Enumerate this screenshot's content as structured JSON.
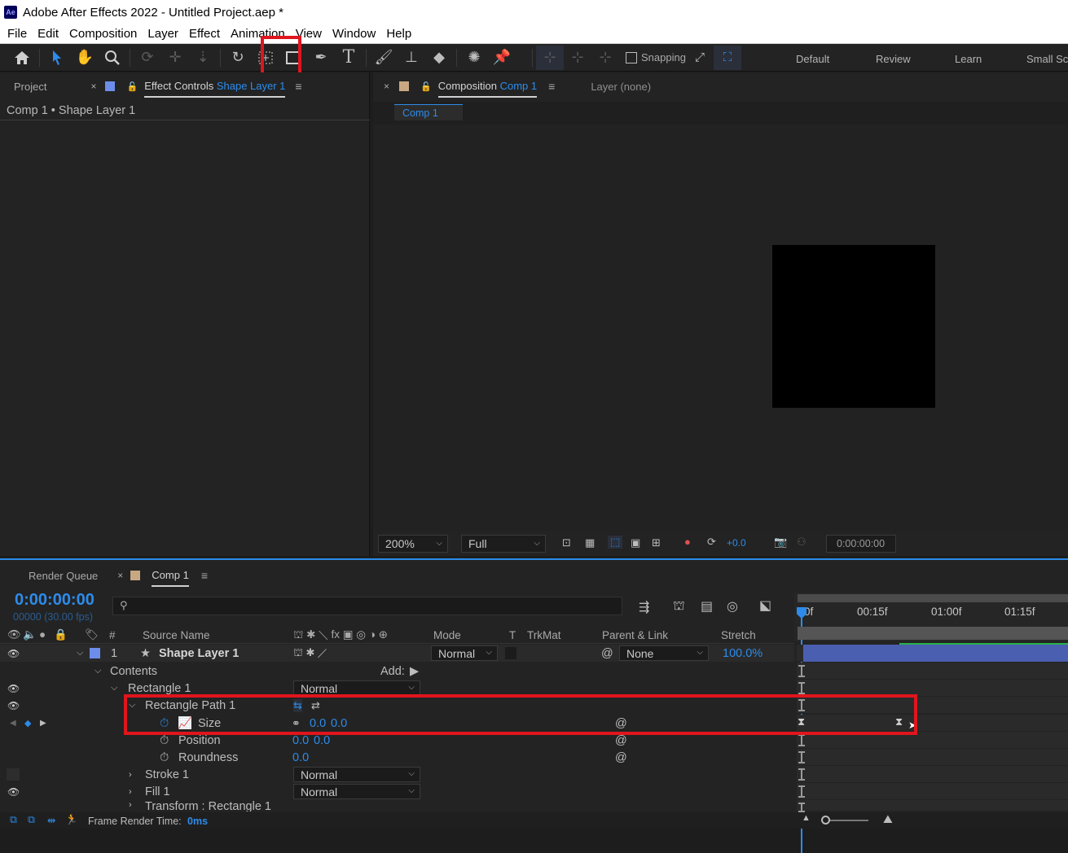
{
  "window": {
    "title": "Adobe After Effects 2022 - Untitled Project.aep *",
    "app_badge": "Ae"
  },
  "menu": [
    "File",
    "Edit",
    "Composition",
    "Layer",
    "Effect",
    "Animation",
    "View",
    "Window",
    "Help"
  ],
  "toolbar": {
    "snapping_label": "Snapping",
    "workspaces": [
      "Default",
      "Review",
      "Learn",
      "Small Sc"
    ]
  },
  "left_panel": {
    "tab_project": "Project",
    "tab_effect_controls": "Effect Controls",
    "tab_effect_controls_target": "Shape Layer 1",
    "breadcrumb": "Comp 1 • Shape Layer 1"
  },
  "comp_panel": {
    "tab_label": "Composition",
    "tab_target": "Comp 1",
    "layer_tab": "Layer (none)",
    "subtab": "Comp 1",
    "zoom": "200%",
    "resolution": "Full",
    "exposure": "+0.0",
    "timecode": "0:00:00:00"
  },
  "timeline": {
    "tab_render_queue": "Render Queue",
    "tab_comp": "Comp 1",
    "timecode": "0:00:00:00",
    "frame_info": "00000 (30.00 fps)",
    "ruler": [
      "0f",
      "00:15f",
      "01:00f",
      "01:15f"
    ],
    "columns": {
      "hash": "#",
      "source_name": "Source Name",
      "mode": "Mode",
      "t": "T",
      "trkmat": "TrkMat",
      "parent": "Parent & Link",
      "stretch": "Stretch"
    },
    "layer": {
      "index": "1",
      "name": "Shape Layer 1",
      "mode": "Normal",
      "parent": "None",
      "stretch": "100.0%"
    },
    "contents_label": "Contents",
    "add_label": "Add:",
    "rect_group": {
      "name": "Rectangle 1",
      "mode": "Normal"
    },
    "rect_path": {
      "name": "Rectangle Path 1"
    },
    "size": {
      "label": "Size",
      "value_x": "0.0",
      "value_y": "0.0"
    },
    "position": {
      "label": "Position",
      "value_x": "0.0",
      "value_y": "0.0"
    },
    "roundness": {
      "label": "Roundness",
      "value": "0.0"
    },
    "stroke": {
      "name": "Stroke 1",
      "mode": "Normal"
    },
    "fill": {
      "name": "Fill 1",
      "mode": "Normal"
    },
    "transform": {
      "name": "Transform : Rectangle 1"
    },
    "footer_label": "Frame Render Time:",
    "footer_value": "0ms"
  },
  "colors": {
    "accent": "#2d8ceb",
    "highlight": "#e0151d",
    "layer_bar": "#4a5fb0"
  }
}
